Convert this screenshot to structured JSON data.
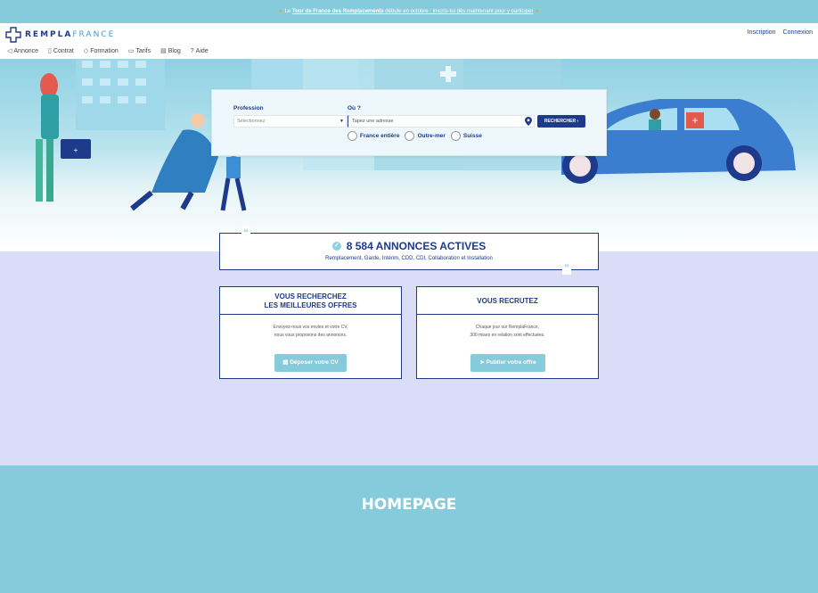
{
  "banner": {
    "prefix": "Le",
    "link_bold": "Tour de France des Remplacements",
    "link_rest": "débute en octobre : inscris-toi dès maintenant pour y participer"
  },
  "brand": {
    "logo_bold": "REMPLA",
    "logo_light": "FRANCE"
  },
  "header": {
    "signup": "Inscription",
    "login": "Connexion"
  },
  "nav": [
    {
      "label": "Annonce",
      "icon": "megaphone-icon"
    },
    {
      "label": "Contrat",
      "icon": "document-icon"
    },
    {
      "label": "Formation",
      "icon": "graduation-cap-icon"
    },
    {
      "label": "Tarifs",
      "icon": "folder-icon"
    },
    {
      "label": "Blog",
      "icon": "newspaper-icon"
    },
    {
      "label": "Aide",
      "icon": "help-icon"
    }
  ],
  "search": {
    "profession_label": "Profession",
    "profession_value": "Sélectionnez",
    "location_label": "Où ?",
    "location_placeholder": "Tapez une adresse",
    "button": "RECHERCHER",
    "options": [
      "France entière",
      "Outre-mer",
      "Suisse"
    ]
  },
  "stats": {
    "title": "8 584 ANNONCES ACTIVES",
    "subtitle": "Remplacement, Garde, Intérim, CDD, CDI, Collaboration et Installation"
  },
  "cards": {
    "seekers": {
      "title_line1": "VOUS RECHERCHEZ",
      "title_line2": "LES MEILLEURES OFFRES",
      "text_line1": "Envoyez-nous vos envies et votre CV,",
      "text_line2": "nous vous proposons des annonces.",
      "button": "Déposer votre CV"
    },
    "recruiters": {
      "title": "VOUS RECRUTEZ",
      "text_line1": "Chaque jour sur RemplaFrance,",
      "text_line2": "300 mises en relation sont effectuées.",
      "button": "Publier votre offre"
    }
  },
  "footer_label": "HOMEPAGE",
  "colors": {
    "navy": "#1e3a8a",
    "teal": "#86cbdc",
    "lavender": "#d9ddf7"
  }
}
